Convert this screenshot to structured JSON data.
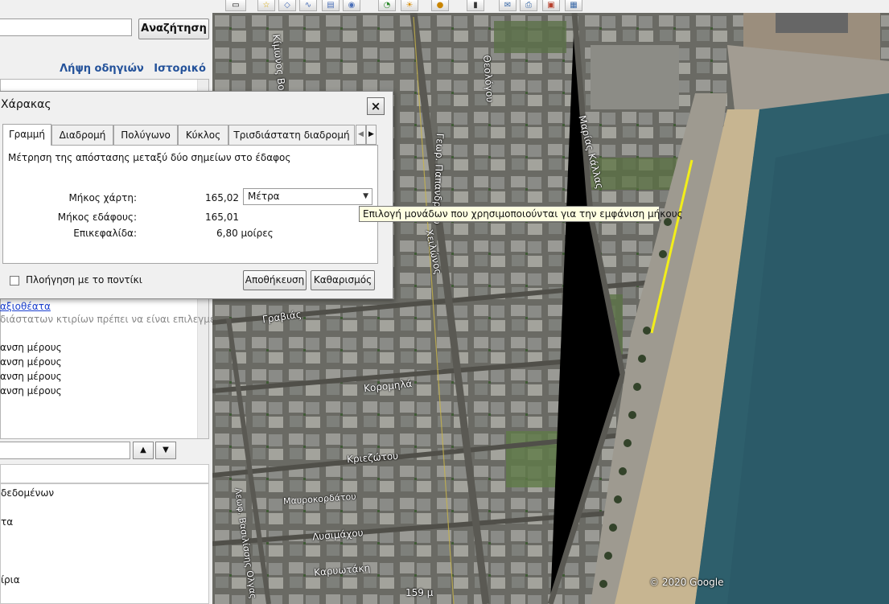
{
  "search": {
    "button_label": "Αναζήτηση",
    "input_value": ""
  },
  "top_links": {
    "directions": "Λήψη οδηγιών",
    "history": "Ιστορικό"
  },
  "places": {
    "link": "αξιοθέατα",
    "note": "διάστατων κτιρίων πρέπει να είναι επιλεγμένο",
    "rows": [
      "ανση μέρους",
      "ανση μέρους",
      "ανση μέρους",
      "ανση μέρους"
    ]
  },
  "nav_controls": {
    "up": "▲",
    "down": "▼"
  },
  "layers": {
    "rows": [
      "δεδομένων",
      "τα",
      "ίρια"
    ]
  },
  "ruler": {
    "title": "Χάρακας",
    "close": "×",
    "tabs": [
      "Γραμμή",
      "Διαδρομή",
      "Πολύγωνο",
      "Κύκλος",
      "Τρισδιάστατη διαδρομή"
    ],
    "active_tab": "Γραμμή",
    "description": "Μέτρηση της απόστασης μεταξύ δύο σημείων στο έδαφος",
    "map_length_label": "Μήκος χάρτη:",
    "map_length_value": "165,02",
    "ground_length_label": "Μήκος εδάφους:",
    "ground_length_value": "165,01",
    "heading_label": "Επικεφαλίδα:",
    "heading_value": "6,80 μοίρες",
    "unit_selected": "Μέτρα",
    "mouse_nav_label": "Πλοήγηση με το ποντίκι",
    "mouse_nav_checked": false,
    "save_label": "Αποθήκευση",
    "clear_label": "Καθαρισμός"
  },
  "tooltip": "Επιλογή μονάδων που χρησιμοποιούνται για την εμφάνιση μήκους",
  "map": {
    "streets": [
      "Κίμωνος Βο",
      "Θεολόγου",
      "Μαρίας Κάλλας",
      "Γεωρ. Παπανδρέου",
      "Χειλώνος",
      "Γραβιάς",
      "Κορομηλά",
      "Κριεζώτου",
      "Μαυροκορδάτου",
      "Λυσιμάχου",
      "Καρυωτάκη",
      "Λεωφ. Βασιλίσσης Ολγας"
    ],
    "copyright": "© 2020 Google",
    "scale_text": "159 μ",
    "colors": {
      "measure_line": "#f2ee1a",
      "sea": "#2e5f6c",
      "beach": "#c7b591"
    }
  }
}
